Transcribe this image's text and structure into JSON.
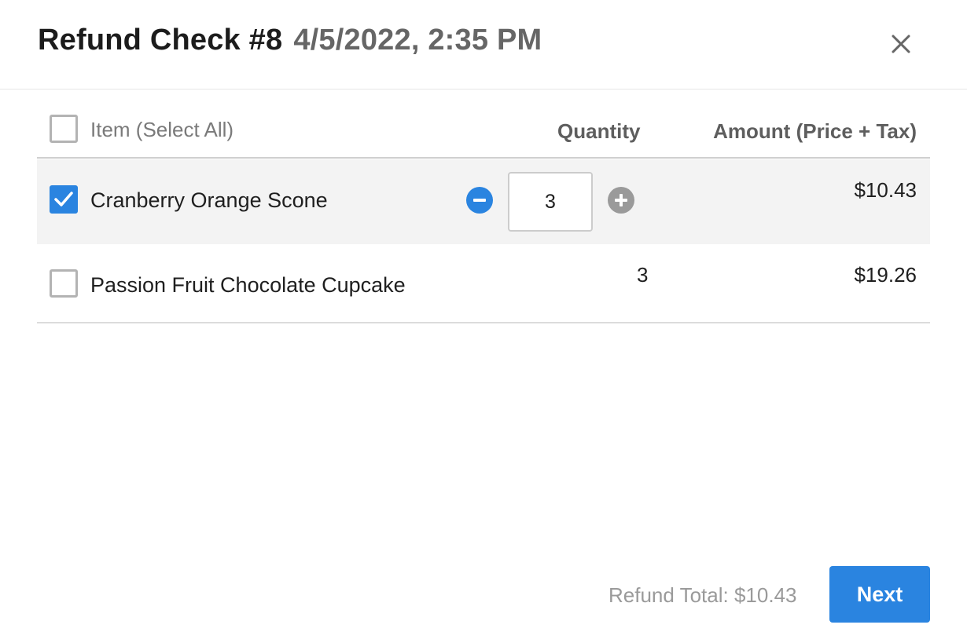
{
  "header": {
    "title": "Refund Check #8",
    "date": "4/5/2022, 2:35 PM",
    "close_icon": "close-icon"
  },
  "table": {
    "columns": {
      "item": "Item (Select All)",
      "quantity": "Quantity",
      "amount": "Amount (Price + Tax)"
    },
    "select_all_checked": false,
    "rows": [
      {
        "name": "Cranberry Orange Scone",
        "checked": true,
        "quantity": "3",
        "amount": "$10.43"
      },
      {
        "name": "Passion Fruit Chocolate Cupcake",
        "checked": false,
        "quantity": "3",
        "amount": "$19.26"
      }
    ]
  },
  "footer": {
    "refund_total": "Refund Total: $10.43",
    "next_label": "Next"
  },
  "colors": {
    "accent": "#2a84e0",
    "stepper_plus": "#9a9a9a",
    "selected_row_bg": "#f3f3f3"
  }
}
